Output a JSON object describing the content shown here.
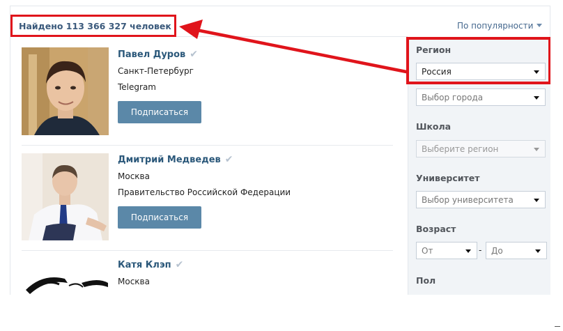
{
  "results": {
    "count_text": "Найдено 113 366 327 человек",
    "sort_label": "По популярности"
  },
  "people": [
    {
      "name": "Павел Дуров",
      "city": "Санкт-Петербург",
      "org": "Telegram",
      "button": "Подписаться"
    },
    {
      "name": "Дмитрий Медведев",
      "city": "Москва",
      "org": "Правительство Российской Федерации",
      "button": "Подписаться"
    },
    {
      "name": "Катя Клэп",
      "city": "Москва"
    }
  ],
  "filters": {
    "region_label": "Регион",
    "region_value": "Россия",
    "city_placeholder": "Выбор города",
    "school_label": "Школа",
    "school_placeholder": "Выберите регион",
    "university_label": "Университет",
    "university_placeholder": "Выбор университета",
    "age_label": "Возраст",
    "age_from": "От",
    "age_to": "До",
    "age_dash": "-",
    "gender_label": "Пол"
  },
  "colors": {
    "highlight_red": "#e0141b",
    "link_blue": "#2b587a",
    "button_blue": "#5b88a8"
  }
}
